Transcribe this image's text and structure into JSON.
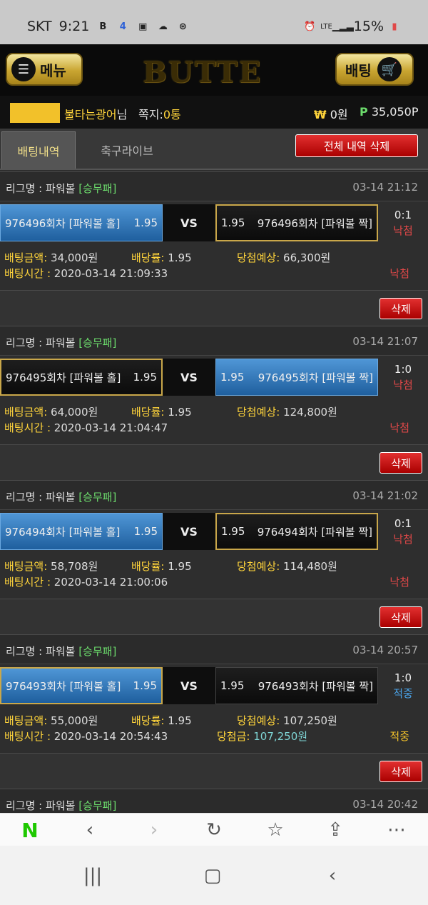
{
  "status": {
    "carrier": "SKT",
    "time": "9:21",
    "network": "LTE",
    "battery": "15%"
  },
  "header": {
    "menu_label": "메뉴",
    "logo": "BUTTE",
    "bet_label": "배팅"
  },
  "user": {
    "name": "불타는광어",
    "suffix": "님",
    "messages_label": "쪽지:",
    "messages_count": "0통",
    "won_symbol": "₩",
    "won": "0원",
    "point_symbol": "P",
    "points": "35,050P"
  },
  "tabs": {
    "history": "배팅내역",
    "live": "축구라이브",
    "delete_all": "전체 내역 삭제"
  },
  "labels": {
    "league": "리그명 : ",
    "vs": "VS",
    "amount": "배팅금액: ",
    "odds": "배당률: ",
    "expected": "당첨예상: ",
    "time": "배팅시간 : ",
    "payout": "당첨금: ",
    "delete": "삭제"
  },
  "bets": [
    {
      "league": "파워볼",
      "type": "[승무패]",
      "date": "03-14 21:12",
      "home": "976496회차 [파워볼 홀]",
      "home_odds": "1.95",
      "away": "976496회차 [파워볼 짝]",
      "away_odds": "1.95",
      "score": "0:1",
      "result": "낙첨",
      "amount": "34,000원",
      "odds": "1.95",
      "expected": "66,300원",
      "time": "2020-03-14 21:09:33",
      "final": "낙첨"
    },
    {
      "league": "파워볼",
      "type": "[승무패]",
      "date": "03-14 21:07",
      "home": "976495회차 [파워볼 홀]",
      "home_odds": "1.95",
      "away": "976495회차 [파워볼 짝]",
      "away_odds": "1.95",
      "score": "1:0",
      "result": "낙첨",
      "amount": "64,000원",
      "odds": "1.95",
      "expected": "124,800원",
      "time": "2020-03-14 21:04:47",
      "final": "낙첨"
    },
    {
      "league": "파워볼",
      "type": "[승무패]",
      "date": "03-14 21:02",
      "home": "976494회차 [파워볼 홀]",
      "home_odds": "1.95",
      "away": "976494회차 [파워볼 짝]",
      "away_odds": "1.95",
      "score": "0:1",
      "result": "낙첨",
      "amount": "58,708원",
      "odds": "1.95",
      "expected": "114,480원",
      "time": "2020-03-14 21:00:06",
      "final": "낙첨"
    },
    {
      "league": "파워볼",
      "type": "[승무패]",
      "date": "03-14 20:57",
      "home": "976493회차 [파워볼 홀]",
      "home_odds": "1.95",
      "away": "976493회차 [파워볼 짝]",
      "away_odds": "1.95",
      "score": "1:0",
      "result": "적중",
      "amount": "55,000원",
      "odds": "1.95",
      "expected": "107,250원",
      "time": "2020-03-14 20:54:43",
      "payout": "107,250원",
      "final": "적중"
    }
  ],
  "partial": {
    "league": "파워볼",
    "type": "[승무패]",
    "date": "03-14 20:42"
  },
  "browser": {
    "n_logo": "N"
  },
  "colors": {
    "gold": "#ffd43b",
    "green": "#6cdc6c",
    "lose": "#e04848",
    "win_score": "#4aa3e8",
    "win_final": "#f2c12a",
    "delete": "#c00000"
  }
}
